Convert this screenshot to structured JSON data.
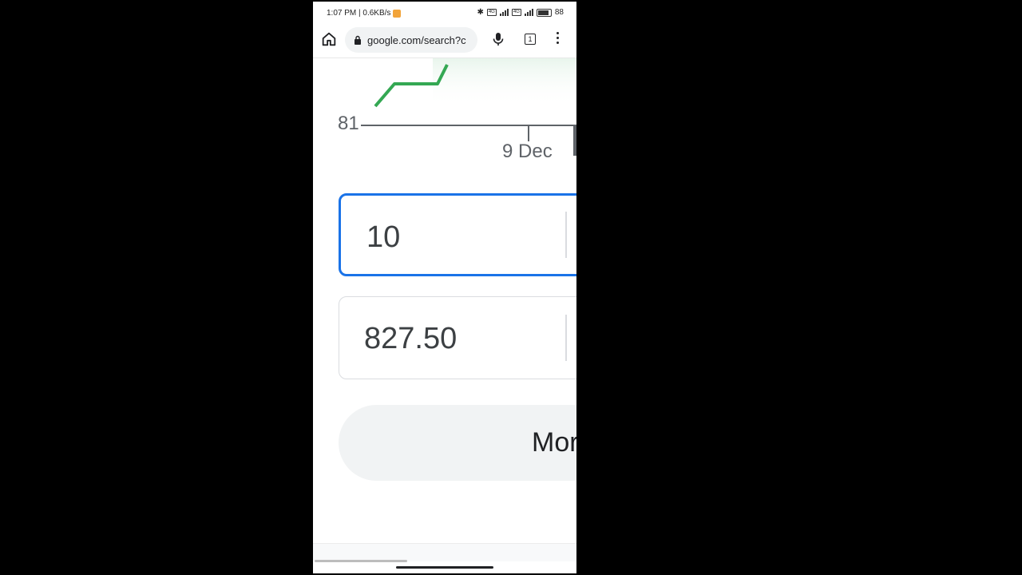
{
  "status_bar": {
    "time_speed": "1:07 PM | 0.6KB/s",
    "battery_text": "88",
    "network_labels": [
      "4G",
      "4G"
    ],
    "accent_color": "#f2a43a"
  },
  "browser": {
    "url": "google.com/search?c",
    "tab_count": "1",
    "icons": [
      "home-icon",
      "lock-icon",
      "mic-icon",
      "tabs-icon",
      "more-vert-icon"
    ]
  },
  "chart_data": {
    "type": "line",
    "title": "",
    "xlabel": "",
    "ylabel": "",
    "y_tick_labels": [
      "81"
    ],
    "x_tick_labels": [
      "9 Dec"
    ],
    "series": [
      {
        "values": [
          81,
          81.7,
          81.7,
          81.7,
          82.3
        ]
      }
    ],
    "line_color": "#34a853",
    "grid": false
  },
  "converter": {
    "amount_value": "10",
    "result_value": "827.50",
    "active_border_color": "#1a73e8"
  },
  "more_button": {
    "label": "Mor"
  }
}
